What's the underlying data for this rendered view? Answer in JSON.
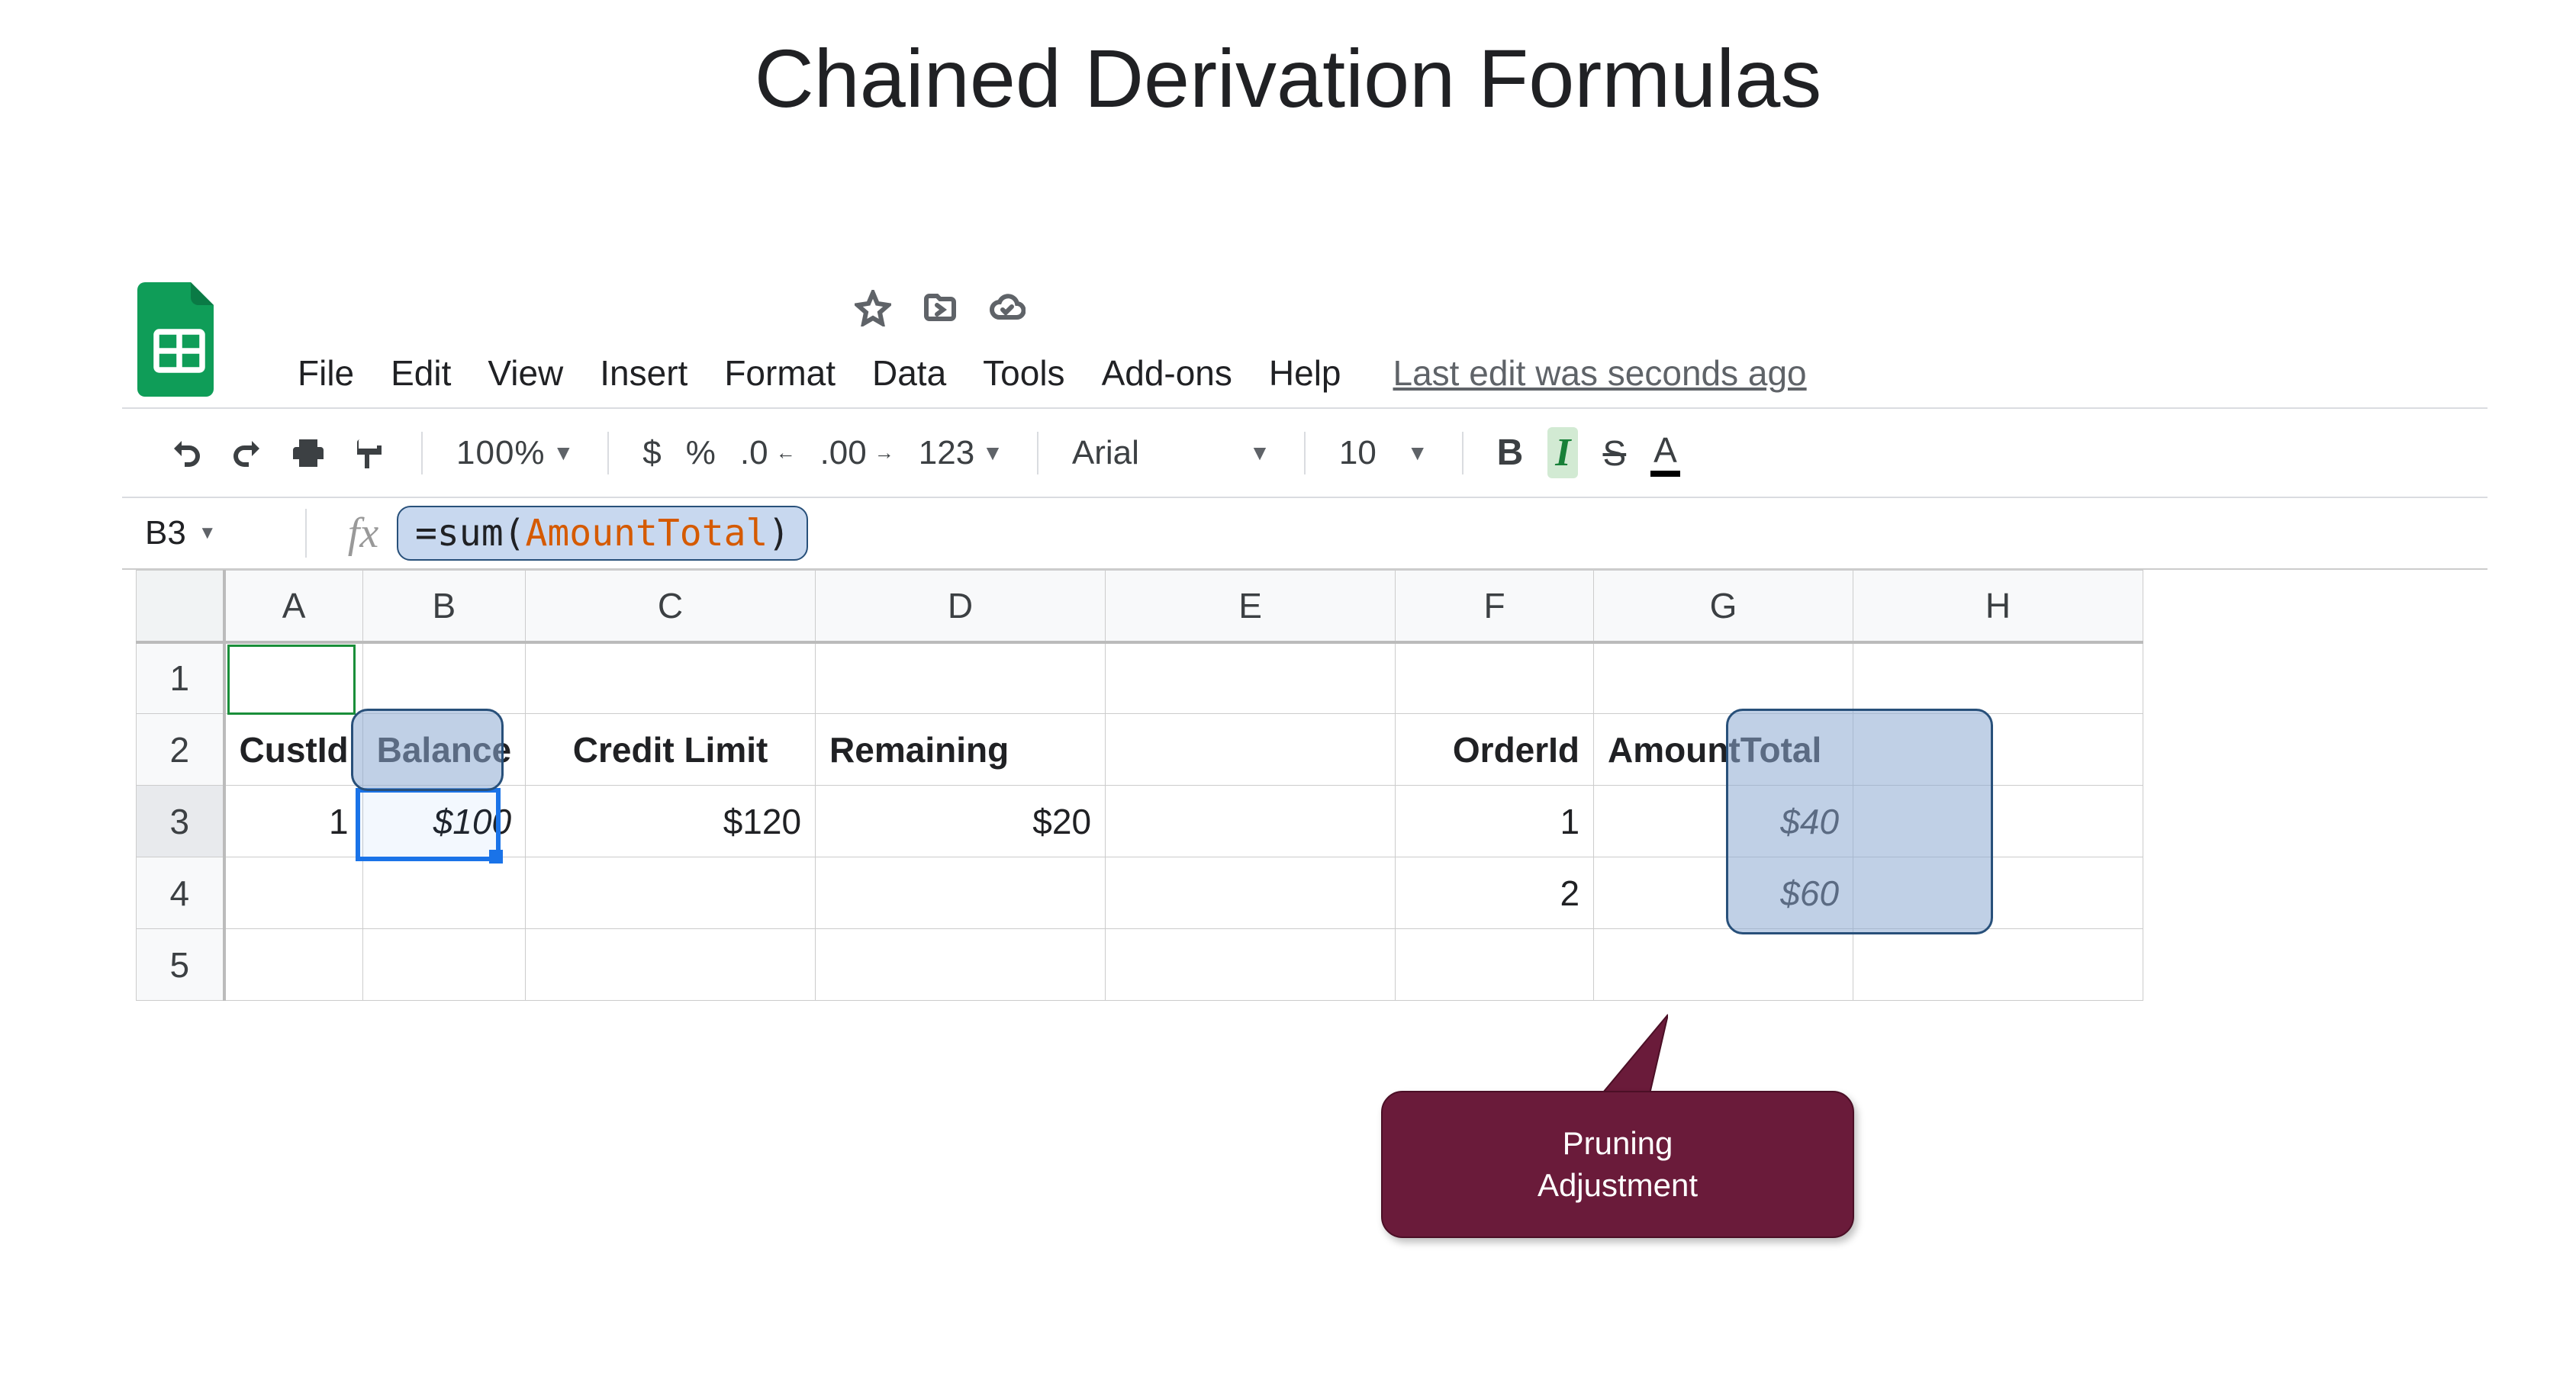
{
  "slide_title": "Chained Derivation Formulas",
  "menu": {
    "file": "File",
    "edit": "Edit",
    "view": "View",
    "insert": "Insert",
    "format": "Format",
    "data": "Data",
    "tools": "Tools",
    "addons": "Add-ons",
    "help": "Help",
    "last_edit": "Last edit was seconds ago"
  },
  "toolbar": {
    "zoom": "100%",
    "currency": "$",
    "percent": "%",
    "dec_less": ".0",
    "dec_more": ".00",
    "numfmt": "123",
    "font": "Arial",
    "fontsize": "10",
    "bold": "B",
    "italic": "I",
    "strike": "S",
    "textcolor": "A"
  },
  "formula_bar": {
    "cell_ref": "B3",
    "prefix": "=sum(",
    "arg": "AmountTotal",
    "suffix": ")"
  },
  "columns": [
    "A",
    "B",
    "C",
    "D",
    "E",
    "F",
    "G",
    "H"
  ],
  "rows": [
    "1",
    "2",
    "3",
    "4",
    "5"
  ],
  "grid": {
    "r1": {
      "A": "",
      "B": "",
      "C": "",
      "D": "",
      "E": "",
      "F": "",
      "G": "",
      "H": ""
    },
    "r2": {
      "A": "CustId",
      "B": "Balance",
      "C": "Credit Limit",
      "D": "Remaining",
      "E": "",
      "F": "OrderId",
      "G": "AmountTotal",
      "H": ""
    },
    "r3": {
      "A": "1",
      "B": "$100",
      "C": "$120",
      "D": "$20",
      "E": "",
      "F": "1",
      "G": "$40",
      "H": ""
    },
    "r4": {
      "A": "",
      "B": "",
      "C": "",
      "D": "",
      "E": "",
      "F": "2",
      "G": "$60",
      "H": ""
    },
    "r5": {
      "A": "",
      "B": "",
      "C": "",
      "D": "",
      "E": "",
      "F": "",
      "G": "",
      "H": ""
    }
  },
  "callout": {
    "line1": "Pruning",
    "line2": "Adjustment"
  }
}
